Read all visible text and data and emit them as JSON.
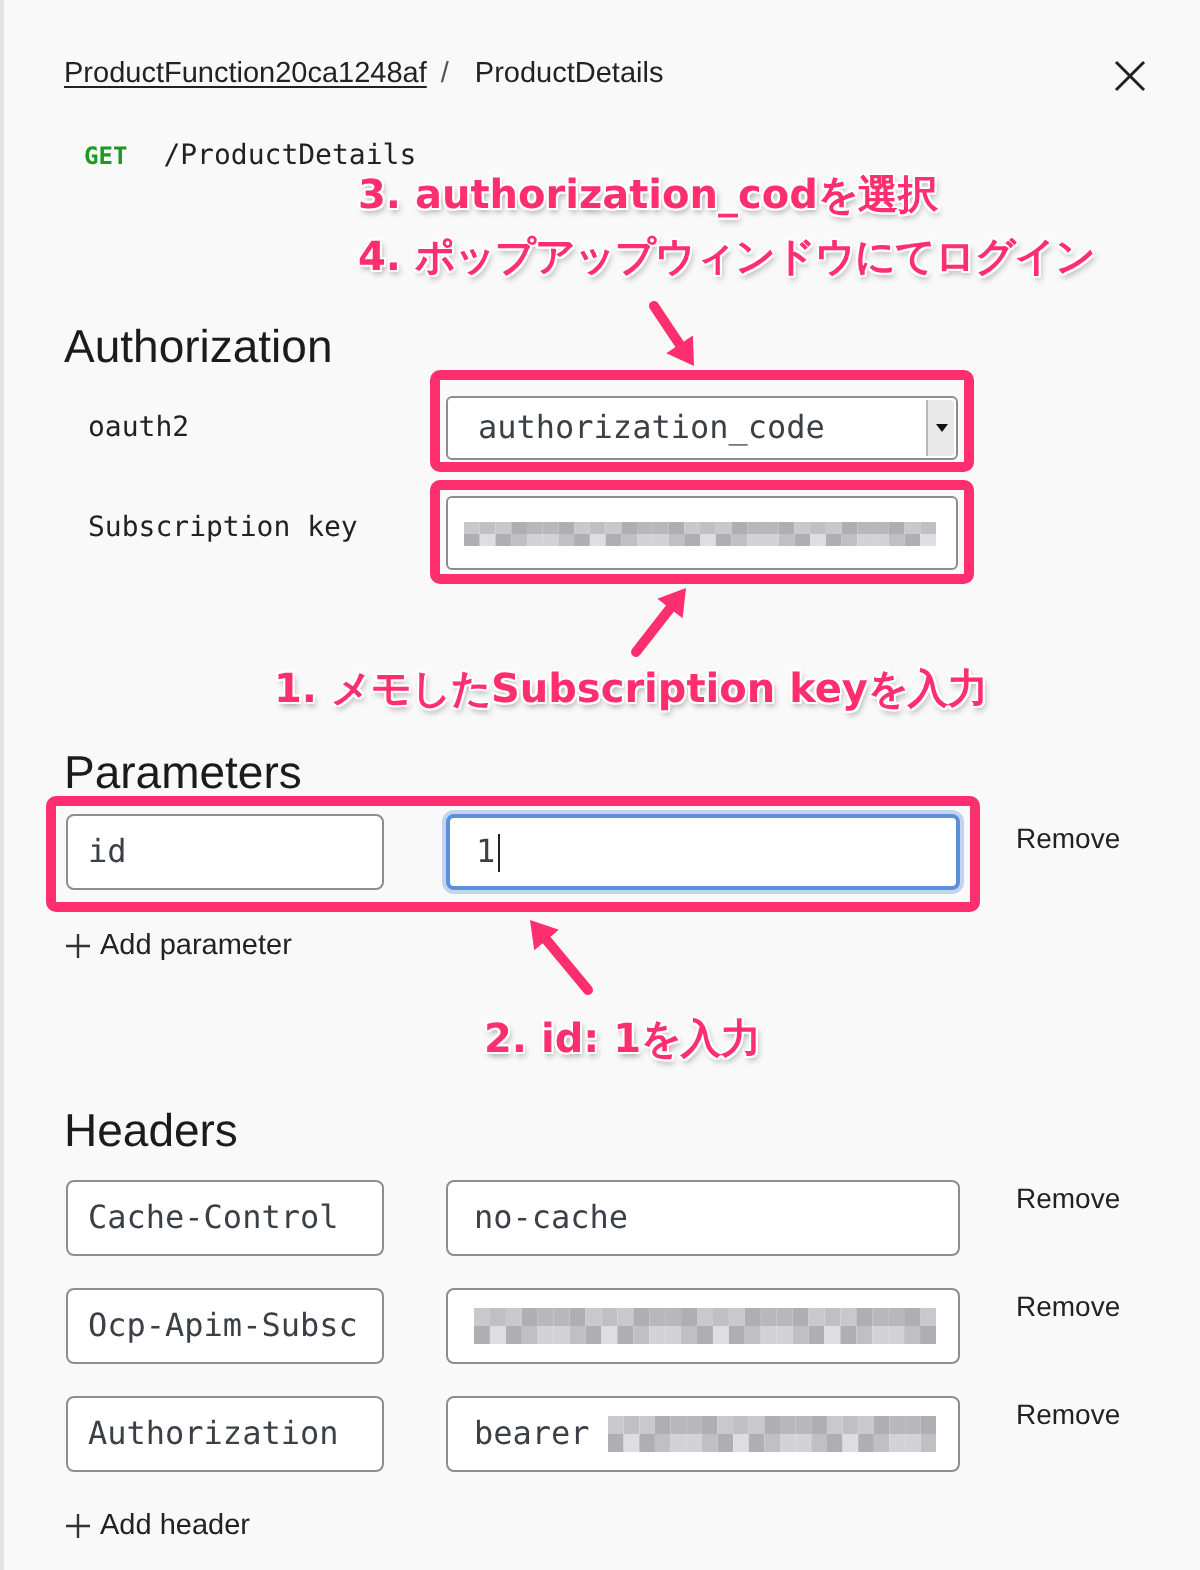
{
  "breadcrumb": {
    "parent": "ProductFunction20ca1248af",
    "separator": "/",
    "current": "ProductDetails"
  },
  "operation": {
    "method": "GET",
    "path": "/ProductDetails"
  },
  "authorization": {
    "title": "Authorization",
    "fields": [
      {
        "kind": "select",
        "label": "oauth2",
        "value": "authorization_code",
        "highlighted": true
      },
      {
        "kind": "input",
        "label": "Subscription key",
        "redacted": true,
        "highlighted": true
      }
    ]
  },
  "parameters": {
    "title": "Parameters",
    "highlighted": true,
    "rows": [
      {
        "name": "id",
        "value": "1",
        "focused": true,
        "remove": "Remove"
      }
    ],
    "add": "Add parameter"
  },
  "headers": {
    "title": "Headers",
    "rows": [
      {
        "name": "Cache-Control",
        "value": "no-cache",
        "redacted": false,
        "remove": "Remove"
      },
      {
        "name": "Ocp-Apim-Subsc",
        "redacted": true,
        "remove": "Remove"
      },
      {
        "name": "Authorization",
        "value": "bearer",
        "redacted": true,
        "remove": "Remove"
      }
    ],
    "add": "Add header"
  },
  "annotations": [
    {
      "text": "3. authorization_codを選択"
    },
    {
      "text": "4. ポップアップウィンドウにてログイン"
    },
    {
      "text": "1. メモしたSubscription keyを入力"
    },
    {
      "text": "2. id: 1を入力"
    }
  ]
}
